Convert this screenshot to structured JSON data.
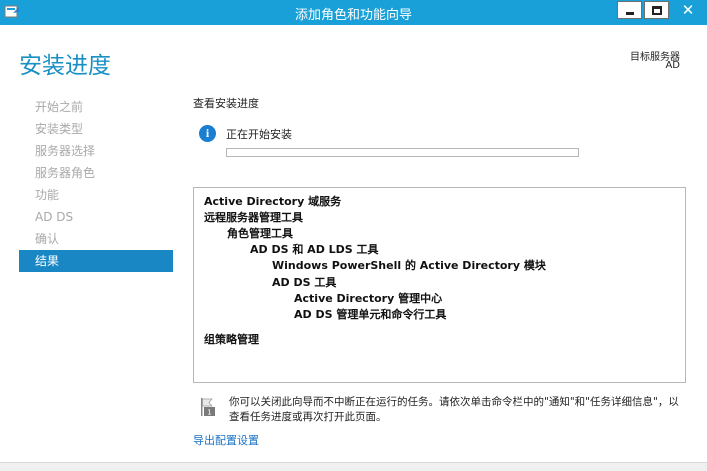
{
  "window": {
    "title": "添加角色和功能向导"
  },
  "header": {
    "page_title": "安装进度",
    "target_server_label": "目标服务器",
    "target_server_value": "AD"
  },
  "nav": {
    "items": [
      {
        "label": "开始之前",
        "active": false
      },
      {
        "label": "安装类型",
        "active": false
      },
      {
        "label": "服务器选择",
        "active": false
      },
      {
        "label": "服务器角色",
        "active": false
      },
      {
        "label": "功能",
        "active": false
      },
      {
        "label": "AD DS",
        "active": false
      },
      {
        "label": "确认",
        "active": false
      },
      {
        "label": "结果",
        "active": true
      }
    ]
  },
  "main": {
    "section_title": "查看安装进度",
    "status_text": "正在开始安装",
    "progress_fraction": 0.0,
    "features": [
      {
        "label": "Active Directory 域服务",
        "level": 0
      },
      {
        "label": "远程服务器管理工具",
        "level": 0
      },
      {
        "label": "角色管理工具",
        "level": 1
      },
      {
        "label": "AD DS 和 AD LDS 工具",
        "level": 2
      },
      {
        "label": "Windows PowerShell 的 Active Directory 模块",
        "level": 3
      },
      {
        "label": "AD DS 工具",
        "level": 3
      },
      {
        "label": "Active Directory 管理中心",
        "level": 4
      },
      {
        "label": "AD DS 管理单元和命令行工具",
        "level": 4
      },
      {
        "label": "组策略管理",
        "level": 0
      }
    ],
    "footer_note": "你可以关闭此向导而不中断正在运行的任务。请依次单击命令栏中的\"通知\"和\"任务详细信息\"，以查看任务进度或再次打开此页面。",
    "export_link": "导出配置设置"
  },
  "colors": {
    "titlebar": "#1aa0d8",
    "accent": "#1a87c5",
    "heading": "#1a8fc4",
    "link": "#1a72c4"
  }
}
